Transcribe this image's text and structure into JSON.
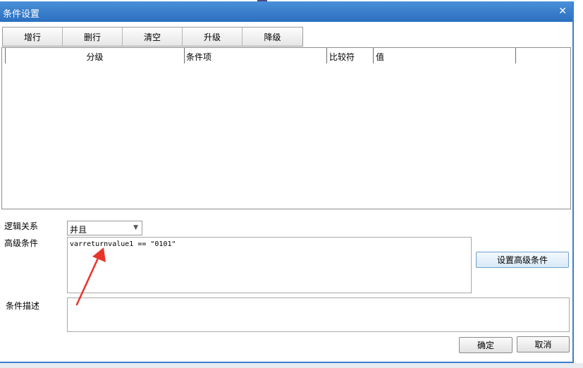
{
  "window": {
    "title": "条件设置",
    "close_glyph": "✕"
  },
  "toolbar": {
    "buttons": [
      "增行",
      "删行",
      "清空",
      "升级",
      "降级"
    ]
  },
  "grid": {
    "columns": [
      "分级",
      "条件项",
      "比较符",
      "值"
    ]
  },
  "form": {
    "logic_label": "逻辑关系",
    "logic_value": "并且",
    "advanced_label": "高级条件",
    "advanced_value": "varreturnvalue1  == \"0101\"",
    "advanced_button": "设置高级条件",
    "desc_label": "条件描述",
    "desc_value": ""
  },
  "footer": {
    "ok": "确定",
    "cancel": "取消"
  },
  "colors": {
    "title_bar": "#2b6fc0",
    "annotation_arrow": "#e8342a"
  },
  "icons": {
    "close": "close-icon",
    "dropdown": "chevron-down-icon"
  }
}
